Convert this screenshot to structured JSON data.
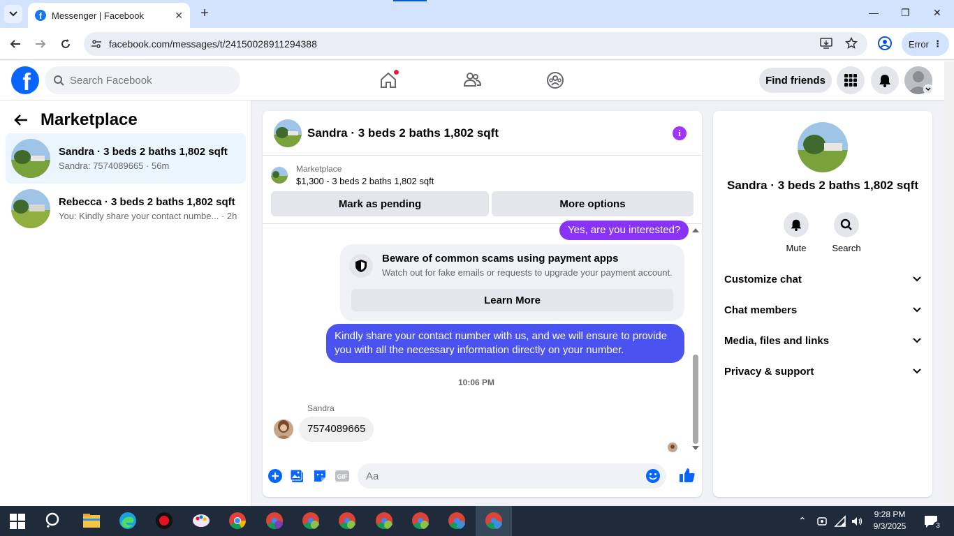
{
  "browser": {
    "tab_title": "Messenger | Facebook",
    "url": "facebook.com/messages/t/24150028911294388",
    "error_label": "Error"
  },
  "fb": {
    "search_placeholder": "Search Facebook",
    "find_friends": "Find friends",
    "logo_letter": "f"
  },
  "left": {
    "title": "Marketplace",
    "conversations": [
      {
        "name": "Sandra · 3 beds 2 baths 1,802 sqft",
        "preview": "Sandra: 7574089665 · 56m"
      },
      {
        "name": "Rebecca · 3 beds 2 baths 1,802 sqft",
        "preview": "You: Kindly share your contact numbe... · 2h"
      }
    ]
  },
  "chat": {
    "title": "Sandra · 3 beds 2 baths 1,802 sqft",
    "info_glyph": "i",
    "marketplace_label": "Marketplace",
    "listing": "$1,300 - 3 beds 2 baths 1,802 sqft",
    "mark_pending": "Mark as pending",
    "more_options": "More options",
    "msg_out_1": "Yes, are you interested?",
    "scam_title": "Beware of common scams using payment apps",
    "scam_desc": "Watch out for fake emails or requests to upgrade your payment account.",
    "learn_more": "Learn More",
    "msg_out_2": "Kindly share your contact number with us, and we will ensure to provide you with all the necessary information directly on your number.",
    "timestamp": "10:06 PM",
    "sender": "Sandra",
    "msg_in_1": "7574089665",
    "composer_placeholder": "Aa"
  },
  "right": {
    "name": "Sandra · 3 beds 2 baths 1,802 sqft",
    "mute": "Mute",
    "search": "Search",
    "sections": [
      "Customize chat",
      "Chat members",
      "Media, files and links",
      "Privacy & support"
    ]
  },
  "taskbar": {
    "time": "9:28 PM",
    "date": "9/3/2025",
    "notif_count": "3"
  },
  "colors": {
    "fb_blue": "#0866ff",
    "bubble_purple": "#8833f5",
    "bubble_blue": "#4a52f0",
    "info_purple": "#a033ff"
  }
}
